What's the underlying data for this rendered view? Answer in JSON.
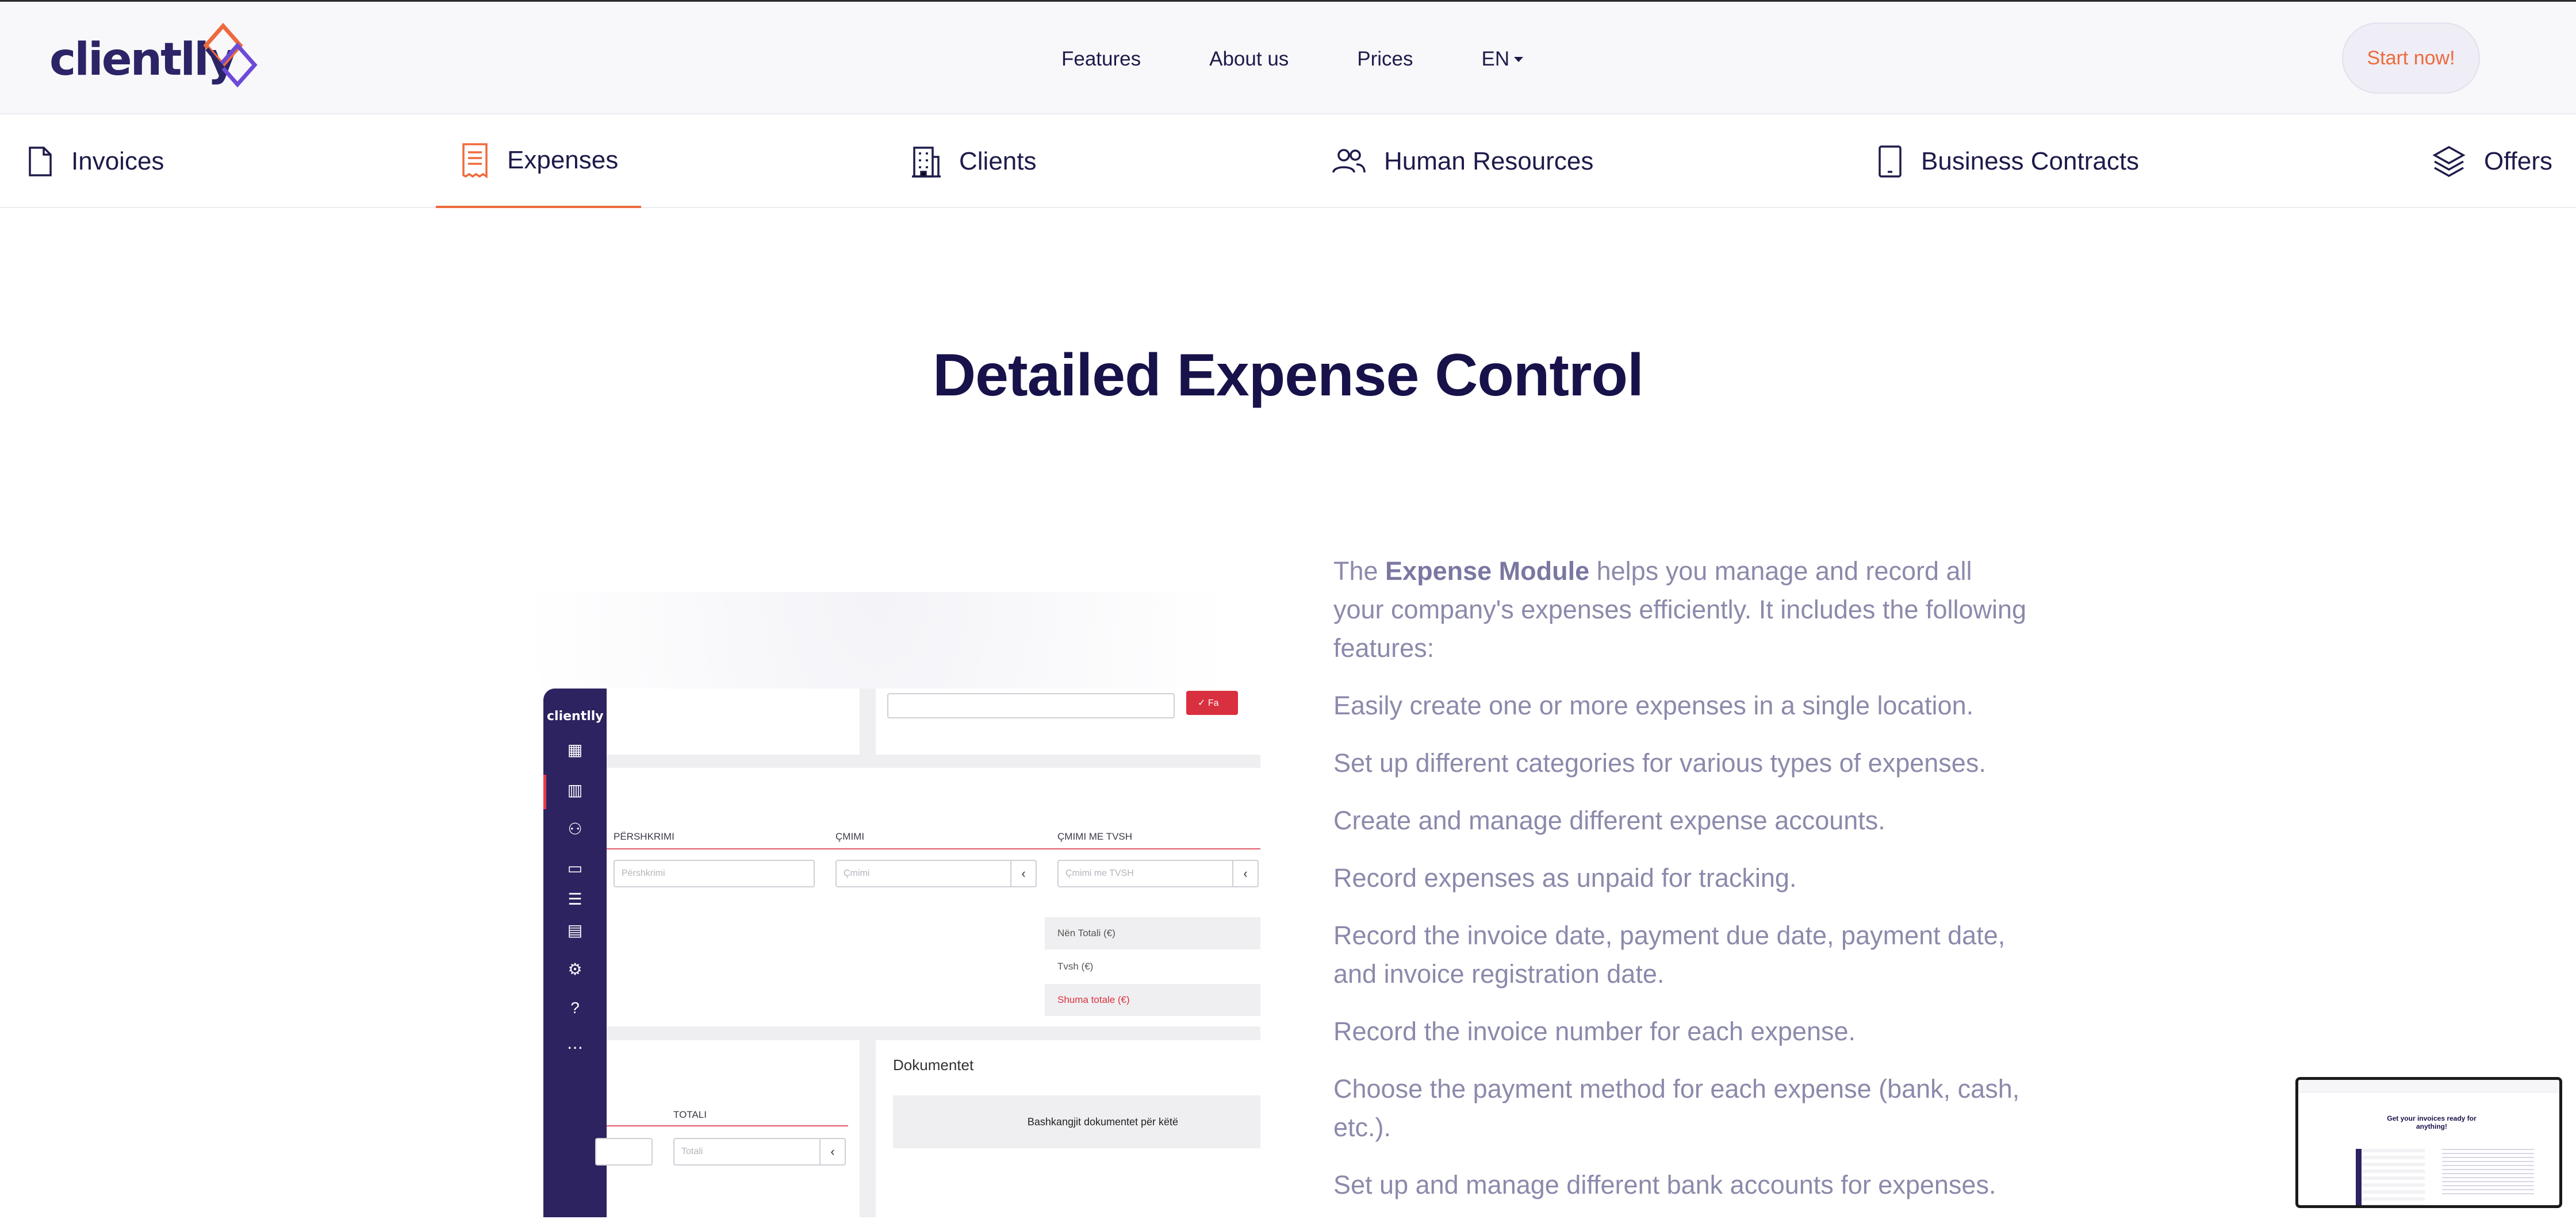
{
  "brand": {
    "name": "clientlly",
    "accent": "#ee6a3c",
    "primary": "#2b2466"
  },
  "nav": {
    "items": [
      "Features",
      "About us",
      "Prices"
    ],
    "lang": "EN",
    "cta": "Start now!"
  },
  "tabs": [
    {
      "label": "Invoices",
      "icon": "document-icon",
      "active": false
    },
    {
      "label": "Expenses",
      "icon": "receipt-icon",
      "active": true
    },
    {
      "label": "Clients",
      "icon": "building-icon",
      "active": false
    },
    {
      "label": "Human Resources",
      "icon": "people-icon",
      "active": false
    },
    {
      "label": "Business Contracts",
      "icon": "tablet-icon",
      "active": false
    },
    {
      "label": "Offers",
      "icon": "layers-icon",
      "active": false
    }
  ],
  "hero": {
    "title": "Detailed Expense Control"
  },
  "mockup": {
    "logo": "clientlly",
    "col1": "PËRSHKRIMI",
    "col2": "ÇMIMI",
    "col3": "ÇMIMI ME TVSH",
    "ph1": "Përshkrimi",
    "ph2": "Çmimi",
    "ph3": "Çmimi me TVSH",
    "subtotal": "Nën Totali (€)",
    "tax": "Tvsh (€)",
    "total": "Shuma totale (€)",
    "col_total": "TOTALI",
    "ph_total": "Totali",
    "docs_title": "Dokumentet",
    "docs_attach": "Bashkangjit dokumentet për këtë",
    "red_btn": "✓ Fa"
  },
  "description": {
    "intro_pre": "The ",
    "intro_bold": "Expense Module",
    "intro_post": " helps you manage and record all your company's expenses efficiently. It includes the following features:",
    "features": [
      "Easily create one or more expenses in a single location.",
      "Set up different categories for various types of expenses.",
      "Create and manage different expense accounts.",
      "Record expenses as unpaid for tracking.",
      "Record the invoice date, payment due date, payment date, and invoice registration date.",
      "Record the invoice number for each expense.",
      "Choose the payment method for each expense (bank, cash, etc.).",
      "Set up and manage different bank accounts for expenses."
    ]
  },
  "mini_preview": {
    "headline": "Get your invoices ready for anything!"
  }
}
